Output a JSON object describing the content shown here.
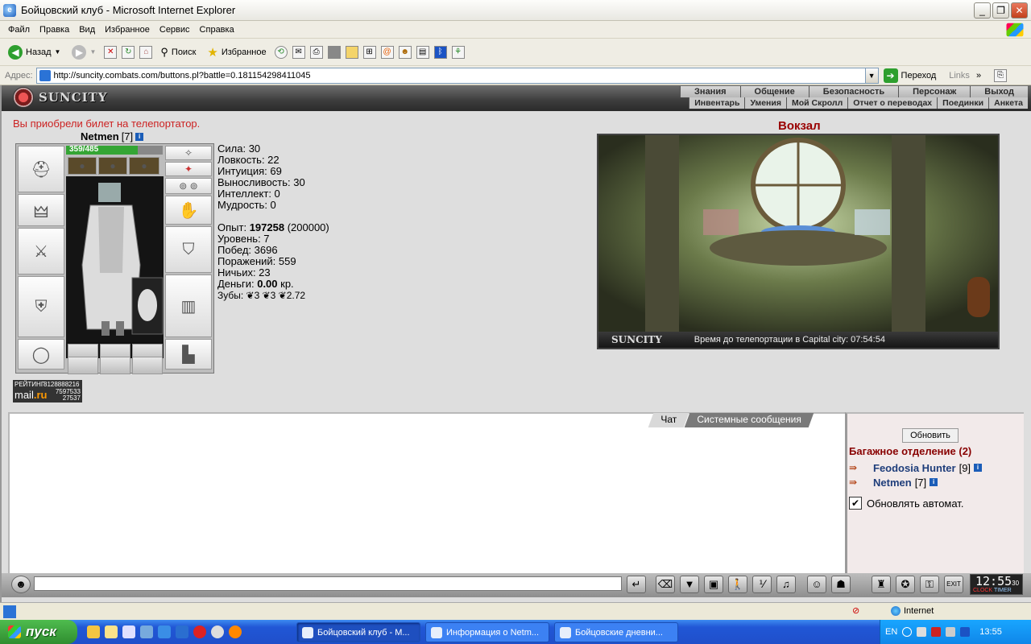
{
  "window": {
    "title": "Бойцовский клуб - Microsoft Internet Explorer",
    "controls": [
      "_",
      "❐",
      "✕"
    ]
  },
  "menu": [
    "Файл",
    "Правка",
    "Вид",
    "Избранное",
    "Сервис",
    "Справка"
  ],
  "toolbar": {
    "back": "Назад",
    "search": "Поиск",
    "favorites": "Избранное"
  },
  "address": {
    "label": "Адрес:",
    "url": "http://suncity.combats.com/buttons.pl?battle=0.181154298411045",
    "go": "Переход",
    "links": "Links"
  },
  "game": {
    "brand": "SUNCITY",
    "nav_top": [
      "Знания",
      "Общение",
      "Безопасность",
      "Персонаж",
      "Выход"
    ],
    "nav_bottom": [
      "Инвентарь",
      "Умения",
      "Мой Скролл",
      "Отчет о переводах",
      "Поединки",
      "Анкета"
    ],
    "notice": "Вы приобрели билет на телепортатор.",
    "character": {
      "name": "Netmen",
      "level": "[7]",
      "hp_text": "359/485",
      "hp_fraction": 0.74
    },
    "stats": [
      "Сила: 30",
      "Ловкость: 22",
      "Интуиция: 69",
      "Выносливость: 30",
      "Интеллект: 0",
      "Мудрость: 0"
    ],
    "progress": {
      "exp_label": "Опыт: ",
      "exp_value": "197258",
      "exp_next": " (200000)",
      "level": "Уровень: 7",
      "wins": "Побед: 3696",
      "losses": "Поражений: 559",
      "draws": "Ничьих: 23",
      "money_label": "Деньги: ",
      "money_value": "0.00",
      "money_unit": " кр.",
      "teeth": "Зубы: ❦3 ❦3 ❦2.72"
    },
    "rating": {
      "label": "РЕЙТИНГ",
      "n1": "8128888216",
      "n2": "7597533",
      "n3": "27537",
      "mail": "mail",
      "ru": ".ru"
    },
    "location": {
      "title": "Вокзал",
      "scene_brand": "SUNCITY",
      "timer": "Время до телепортации в Capital city: 07:54:54"
    }
  },
  "chat": {
    "tabs": [
      "Чат",
      "Системные сообщения"
    ],
    "refresh": "Обновить",
    "room": "Багажное отделение (2)",
    "players": [
      {
        "name": "Feodosia Hunter",
        "level": "[9]"
      },
      {
        "name": "Netmen",
        "level": "[7]"
      }
    ],
    "auto_refresh": "Обновлять автомат.",
    "auto_checked": "✔",
    "clock_time": "12:55",
    "clock_sec": "30",
    "clock_label1": "CLOCK",
    "clock_label2": "TIMER"
  },
  "statusbar": {
    "zone": "Internet"
  },
  "taskbar": {
    "start": "пуск",
    "tasks": [
      "Бойцовский клуб - M...",
      "Информация о Netm...",
      "Бойцовские дневни..."
    ],
    "lang": "EN",
    "time": "13:55"
  }
}
